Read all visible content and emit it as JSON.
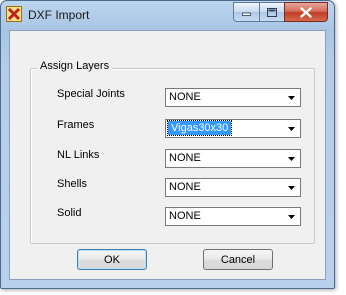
{
  "window": {
    "title": "DXF Import"
  },
  "group": {
    "label": "Assign Layers"
  },
  "rows": [
    {
      "label": "Special Joints",
      "value": "NONE",
      "selected": false
    },
    {
      "label": "Frames",
      "value": "Vigas30x30",
      "selected": true
    },
    {
      "label": "NL Links",
      "value": "NONE",
      "selected": false
    },
    {
      "label": "Shells",
      "value": "NONE",
      "selected": false
    },
    {
      "label": "Solid",
      "value": "NONE",
      "selected": false
    }
  ],
  "buttons": {
    "ok": "OK",
    "cancel": "Cancel"
  },
  "icons": {
    "app": "dxf-app-icon",
    "minimize": "minimize-icon",
    "maximize": "maximize-icon",
    "close": "close-icon",
    "dropdown": "chevron-down-icon"
  },
  "colors": {
    "selection": "#3399ff",
    "close_button": "#c13d26"
  }
}
